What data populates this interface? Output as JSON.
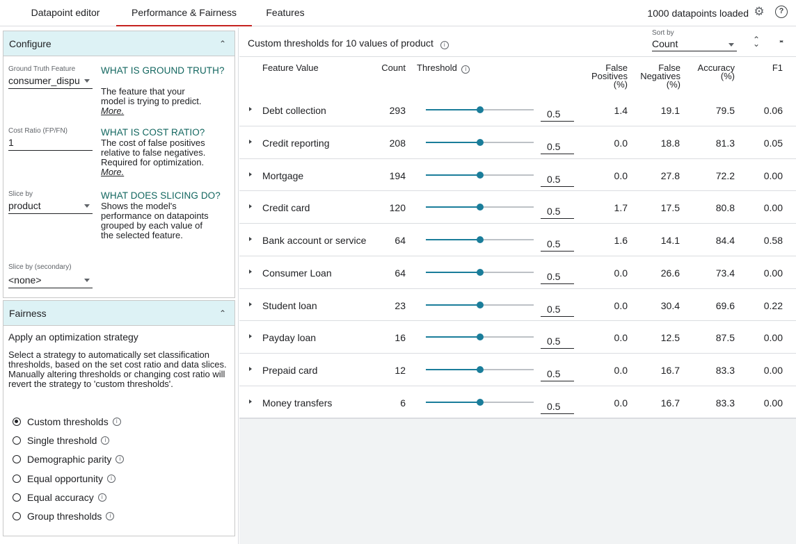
{
  "tabs": [
    {
      "label": "Datapoint editor",
      "active": false
    },
    {
      "label": "Performance & Fairness",
      "active": true
    },
    {
      "label": "Features",
      "active": false
    }
  ],
  "status": {
    "loaded_text": "1000 datapoints loaded",
    "settings_icon": "gear-icon",
    "help_icon": "help-icon"
  },
  "configure": {
    "title": "Configure",
    "ground_truth": {
      "label": "Ground Truth Feature",
      "value": "consumer_dispu",
      "help_title": "WHAT IS GROUND TRUTH?",
      "help_text": "The feature that your model is trying to predict.",
      "more": "More."
    },
    "cost_ratio": {
      "label": "Cost Ratio (FP/FN)",
      "value": "1",
      "help_title": "WHAT IS COST RATIO?",
      "help_text": "The cost of false positives relative to false negatives. Required for optimization.",
      "more": "More."
    },
    "slice_by": {
      "label": "Slice by",
      "value": "product",
      "help_title": "WHAT DOES SLICING DO?",
      "help_text": "Shows the model's performance on datapoints grouped by each value of the selected feature."
    },
    "slice_secondary": {
      "label": "Slice by (secondary)",
      "value": "<none>"
    }
  },
  "fairness": {
    "title": "Fairness",
    "subtitle": "Apply an optimization strategy",
    "description": "Select a strategy to automatically set classification thresholds, based on the set cost ratio and data slices. Manually altering thresholds or changing cost ratio will revert the strategy to 'custom thresholds'.",
    "strategies": [
      {
        "label": "Custom thresholds",
        "selected": true
      },
      {
        "label": "Single threshold",
        "selected": false
      },
      {
        "label": "Demographic parity",
        "selected": false
      },
      {
        "label": "Equal opportunity",
        "selected": false
      },
      {
        "label": "Equal accuracy",
        "selected": false
      },
      {
        "label": "Group thresholds",
        "selected": false
      }
    ]
  },
  "table": {
    "title": "Custom thresholds for 10 values of product",
    "sort_label": "Sort by",
    "sort_value": "Count",
    "headers": {
      "feature_value": "Feature Value",
      "count": "Count",
      "threshold": "Threshold",
      "fp": [
        "False",
        "Positives",
        "(%)"
      ],
      "fn": [
        "False",
        "Negatives",
        "(%)"
      ],
      "accuracy": [
        "Accuracy",
        "(%)"
      ],
      "f1": "F1"
    },
    "rows": [
      {
        "name": "Debt collection",
        "count": "293",
        "threshold": "0.5",
        "threshold_value": 0.5,
        "fp": "1.4",
        "fn": "19.1",
        "acc": "79.5",
        "f1": "0.06"
      },
      {
        "name": "Credit reporting",
        "count": "208",
        "threshold": "0.5",
        "threshold_value": 0.5,
        "fp": "0.0",
        "fn": "18.8",
        "acc": "81.3",
        "f1": "0.05"
      },
      {
        "name": "Mortgage",
        "count": "194",
        "threshold": "0.5",
        "threshold_value": 0.5,
        "fp": "0.0",
        "fn": "27.8",
        "acc": "72.2",
        "f1": "0.00"
      },
      {
        "name": "Credit card",
        "count": "120",
        "threshold": "0.5",
        "threshold_value": 0.5,
        "fp": "1.7",
        "fn": "17.5",
        "acc": "80.8",
        "f1": "0.00"
      },
      {
        "name": "Bank account or service",
        "count": "64",
        "threshold": "0.5",
        "threshold_value": 0.5,
        "fp": "1.6",
        "fn": "14.1",
        "acc": "84.4",
        "f1": "0.58"
      },
      {
        "name": "Consumer Loan",
        "count": "64",
        "threshold": "0.5",
        "threshold_value": 0.5,
        "fp": "0.0",
        "fn": "26.6",
        "acc": "73.4",
        "f1": "0.00"
      },
      {
        "name": "Student loan",
        "count": "23",
        "threshold": "0.5",
        "threshold_value": 0.5,
        "fp": "0.0",
        "fn": "30.4",
        "acc": "69.6",
        "f1": "0.22"
      },
      {
        "name": "Payday loan",
        "count": "16",
        "threshold": "0.5",
        "threshold_value": 0.5,
        "fp": "0.0",
        "fn": "12.5",
        "acc": "87.5",
        "f1": "0.00"
      },
      {
        "name": "Prepaid card",
        "count": "12",
        "threshold": "0.5",
        "threshold_value": 0.5,
        "fp": "0.0",
        "fn": "16.7",
        "acc": "83.3",
        "f1": "0.00"
      },
      {
        "name": "Money transfers",
        "count": "6",
        "threshold": "0.5",
        "threshold_value": 0.5,
        "fp": "0.0",
        "fn": "16.7",
        "acc": "83.3",
        "f1": "0.00"
      }
    ]
  },
  "colors": {
    "accent": "#c5221f",
    "header_bg": "#ddf2f5",
    "slider": "#1a7d9a",
    "help_title": "#12665f"
  }
}
